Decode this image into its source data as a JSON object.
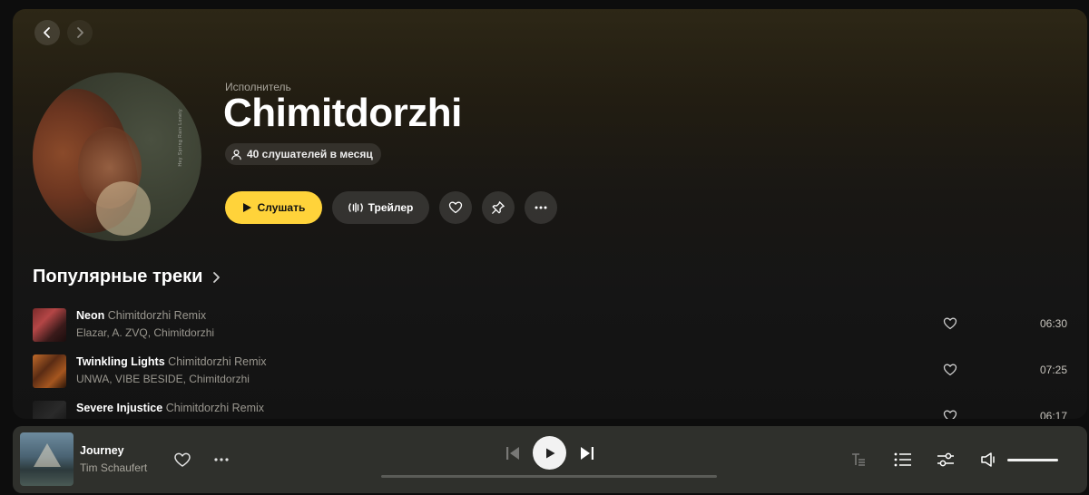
{
  "artist": {
    "type_label": "Исполнитель",
    "name": "Chimitdorzhi",
    "listeners": "40 слушателей в месяц",
    "cover_text": "Hey Spring Rain Lonely"
  },
  "actions": {
    "listen_label": "Слушать",
    "trailer_label": "Трейлер"
  },
  "section": {
    "popular_title": "Популярные треки"
  },
  "tracks": [
    {
      "title": "Neon",
      "remix": "Chimitdorzhi Remix",
      "artists": "Elazar, A. ZVQ, Chimitdorzhi",
      "duration": "06:30"
    },
    {
      "title": "Twinkling Lights",
      "remix": "Chimitdorzhi Remix",
      "artists": "UNWA, VIBE BESIDE, Chimitdorzhi",
      "duration": "07:25"
    },
    {
      "title": "Severe Injustice",
      "remix": "Chimitdorzhi Remix",
      "artists": "",
      "duration": "06:17"
    }
  ],
  "player": {
    "title": "Journey",
    "artist": "Tim Schaufert",
    "volume_level": 1.0,
    "progress": 0.0
  },
  "colors": {
    "accent": "#ffd33a",
    "background": "#151515",
    "player_bg": "#2f302c"
  },
  "icons": [
    "chevron-left-icon",
    "chevron-right-icon",
    "user-icon",
    "play-icon",
    "trailer-wave-icon",
    "heart-icon",
    "pin-icon",
    "more-dots-icon",
    "prev-track-icon",
    "next-track-icon",
    "lyrics-icon",
    "queue-icon",
    "equalizer-icon",
    "volume-icon"
  ]
}
